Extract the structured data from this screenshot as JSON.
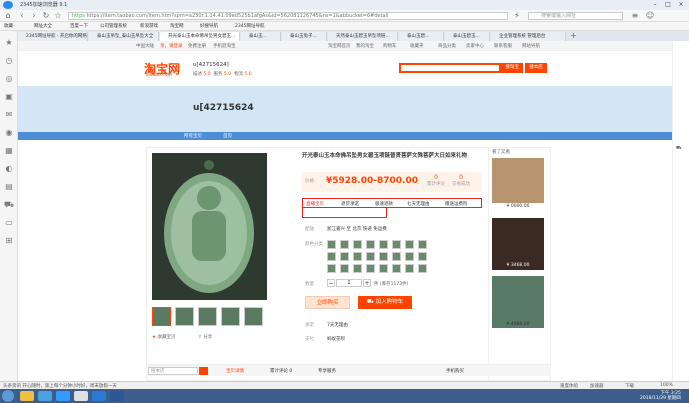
{
  "browser": {
    "title": "2345加速浏览器 9.1",
    "url_secure": "https",
    "url": "https://item.taobao.com/item.htm?spm=a230r.1.14.41.09ed525b1afgAs&id=562081126745&ns=1&abbucket=6#detail",
    "search_placeholder": "搜索或输入网址",
    "fav_items": [
      "收藏",
      "网址大全",
      "百度一下",
      "公司管理系统",
      "新浪游戏",
      "淘宝网",
      "好搜导航",
      "2345网址导航"
    ],
    "tabs": [
      "2345网址导航 - 开启你的网络生活",
      "泰山玉吊坠_泰山玉吊坠大全",
      "开光泰山玉本命佛吊坠男女碧玉...",
      "泰山玉...",
      "泰山玉兔子...",
      "天然泰山玉碧玉吊坠项链...",
      "泰山玉碧...",
      "泰山玉碧玉...",
      "企业管理系统 管理后台"
    ]
  },
  "site_nav": {
    "left": [
      "中国大陆",
      "亲，请登录",
      "免费注册",
      "手机逛淘宝"
    ],
    "right": [
      "淘宝网首页",
      "我的淘宝",
      "购物车",
      "收藏夹",
      "商品分类",
      "卖家中心",
      "联系客服",
      "网站导航"
    ]
  },
  "logo": {
    "text": "淘宝网",
    "sub": "Taobao.com"
  },
  "shop": {
    "name": "u[42715624]",
    "ratings": [
      {
        "label": "描述",
        "value": "5.0"
      },
      {
        "label": "服务",
        "value": "5.0"
      },
      {
        "label": "物流",
        "value": "5.0"
      }
    ],
    "search_btn": "搜淘宝",
    "search_shop_btn": "搜本店",
    "links": [
      "所有宝贝",
      "首页"
    ]
  },
  "banner": {
    "title": "u[42715624"
  },
  "product": {
    "title": "开光泰山玉本命佛吊坠男女碧玉项链普贤菩萨文殊菩萨大日如来礼物",
    "price_label": "价格",
    "price": "¥5928.00-8700.00",
    "stats": [
      {
        "n": "0",
        "label": "累计评论"
      },
      {
        "n": "0",
        "label": "交易成功"
      }
    ],
    "services": [
      "直播宝贝",
      "退货承诺",
      "极速退款",
      "七天无理由",
      "赠送运费险"
    ],
    "delivery_label": "配送",
    "delivery_value": "浙江嘉兴 至 北京 快递 免运费",
    "spec_label": "颜色分类",
    "qty_label": "数量",
    "qty_value": "1",
    "stock": "件 (库存1173件)",
    "buy_btn": "立即购买",
    "cart_btn": "加入购物车",
    "promise_label": "承诺",
    "promise_value": "7天无理由",
    "pay_label": "支付",
    "pay_value": "蚂蚁花呗",
    "collect": "收藏宝贝",
    "share": "分享"
  },
  "side": {
    "header": "看了又看",
    "items": [
      {
        "price": "¥ 0000.00"
      },
      {
        "price": "¥ 3468.00"
      },
      {
        "price": "¥ 4988.00"
      }
    ]
  },
  "bottom": {
    "search_placeholder": "搜本店",
    "tabs": [
      "宝贝详情",
      "累计评论 0",
      "专享服务"
    ],
    "right": "手机购买"
  },
  "status_bar": {
    "left": "头条资讯  开心随时，第上每个分钟小时好，周末放假一天",
    "right": [
      "速度体验",
      "加速器",
      "下载",
      "100%"
    ]
  },
  "taskbar": {
    "time": "下午 3:25",
    "date": "2018/11/29 星期四"
  },
  "colors": {
    "brand": "#ff4400",
    "banner": "#d4e6f6",
    "nav": "#4d8dd6"
  }
}
